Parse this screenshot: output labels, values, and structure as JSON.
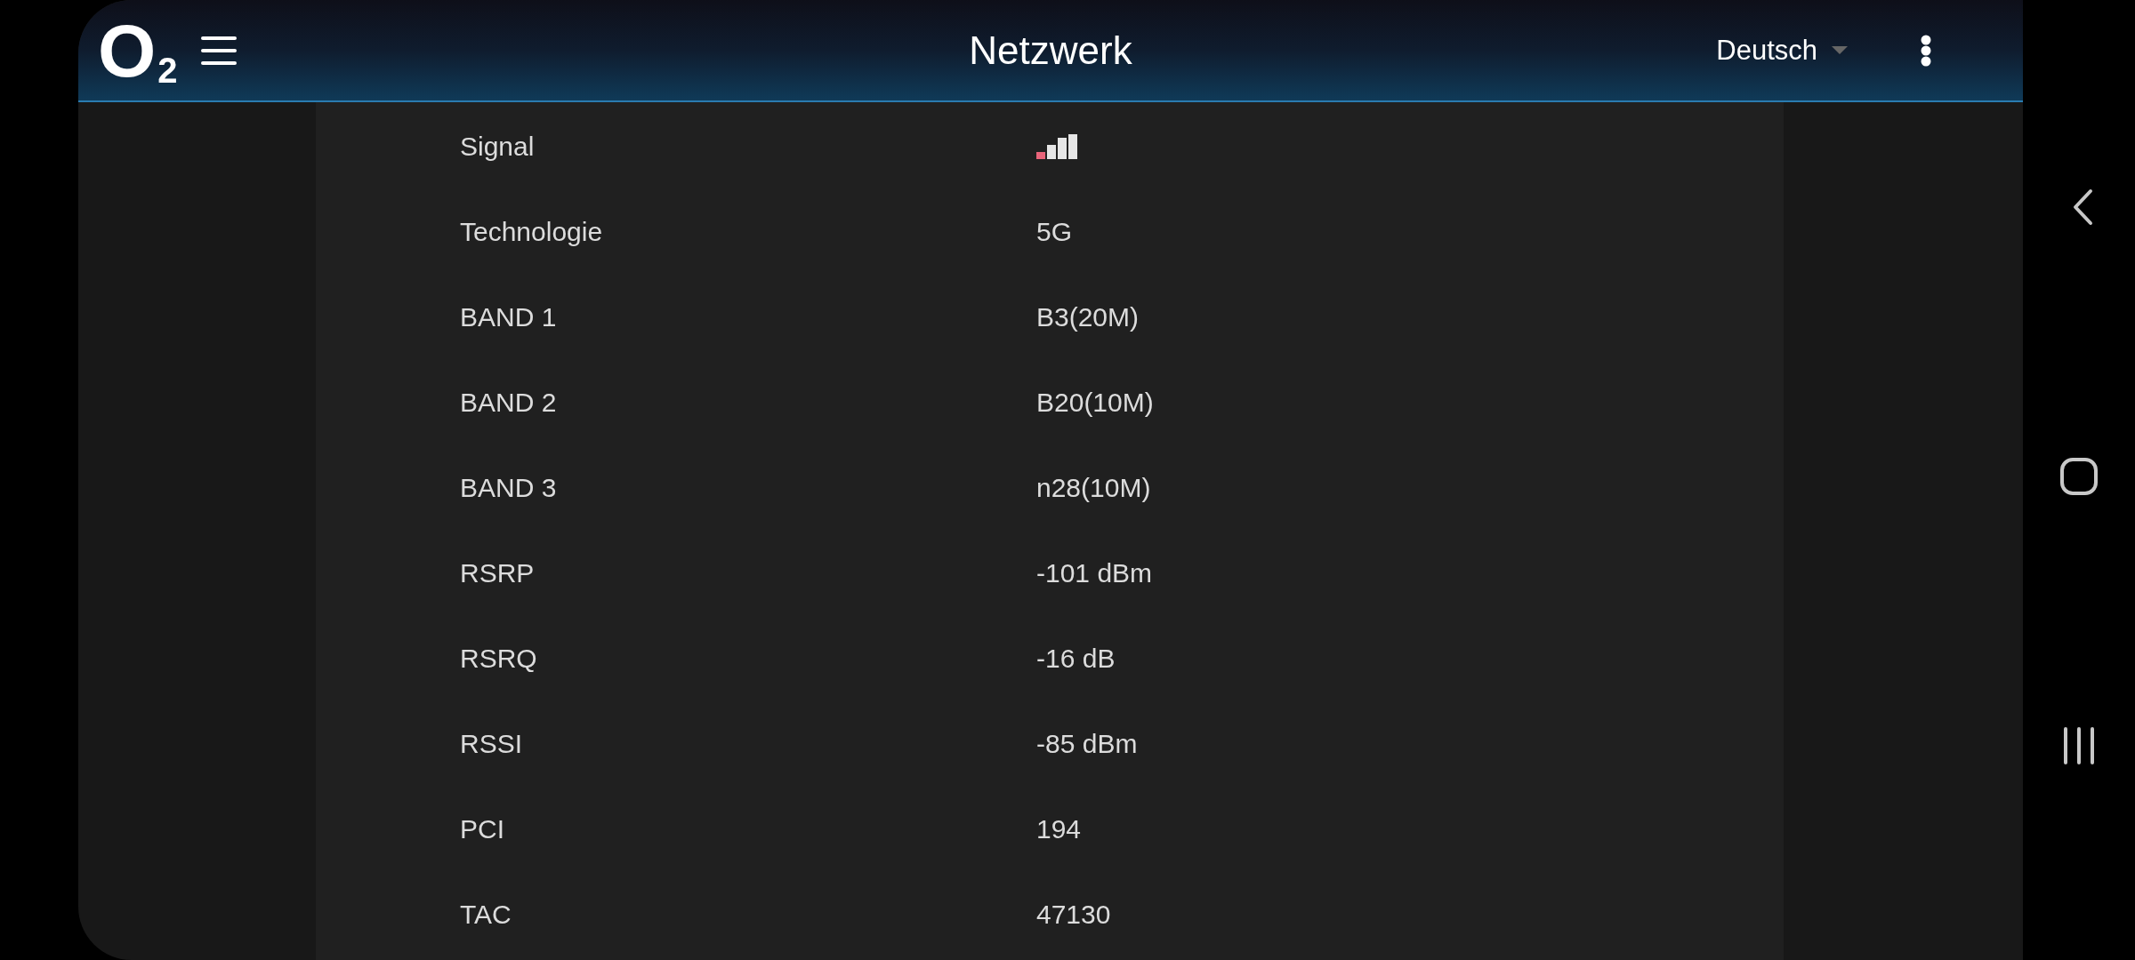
{
  "header": {
    "logo": "O",
    "logo_sub": "2",
    "title": "Netzwerk",
    "language": "Deutsch"
  },
  "rows": [
    {
      "kind": "signal",
      "label": "Signal"
    },
    {
      "kind": "text",
      "label": "Technologie",
      "value": "5G"
    },
    {
      "kind": "text",
      "label": "BAND 1",
      "value": "B3(20M)"
    },
    {
      "kind": "text",
      "label": "BAND 2",
      "value": "B20(10M)"
    },
    {
      "kind": "text",
      "label": "BAND 3",
      "value": "n28(10M)"
    },
    {
      "kind": "text",
      "label": "RSRP",
      "value": "-101 dBm"
    },
    {
      "kind": "text",
      "label": "RSRQ",
      "value": "-16 dB"
    },
    {
      "kind": "text",
      "label": "RSSI",
      "value": "-85 dBm"
    },
    {
      "kind": "text",
      "label": "PCI",
      "value": "194"
    },
    {
      "kind": "text",
      "label": "TAC",
      "value": "47130"
    }
  ]
}
